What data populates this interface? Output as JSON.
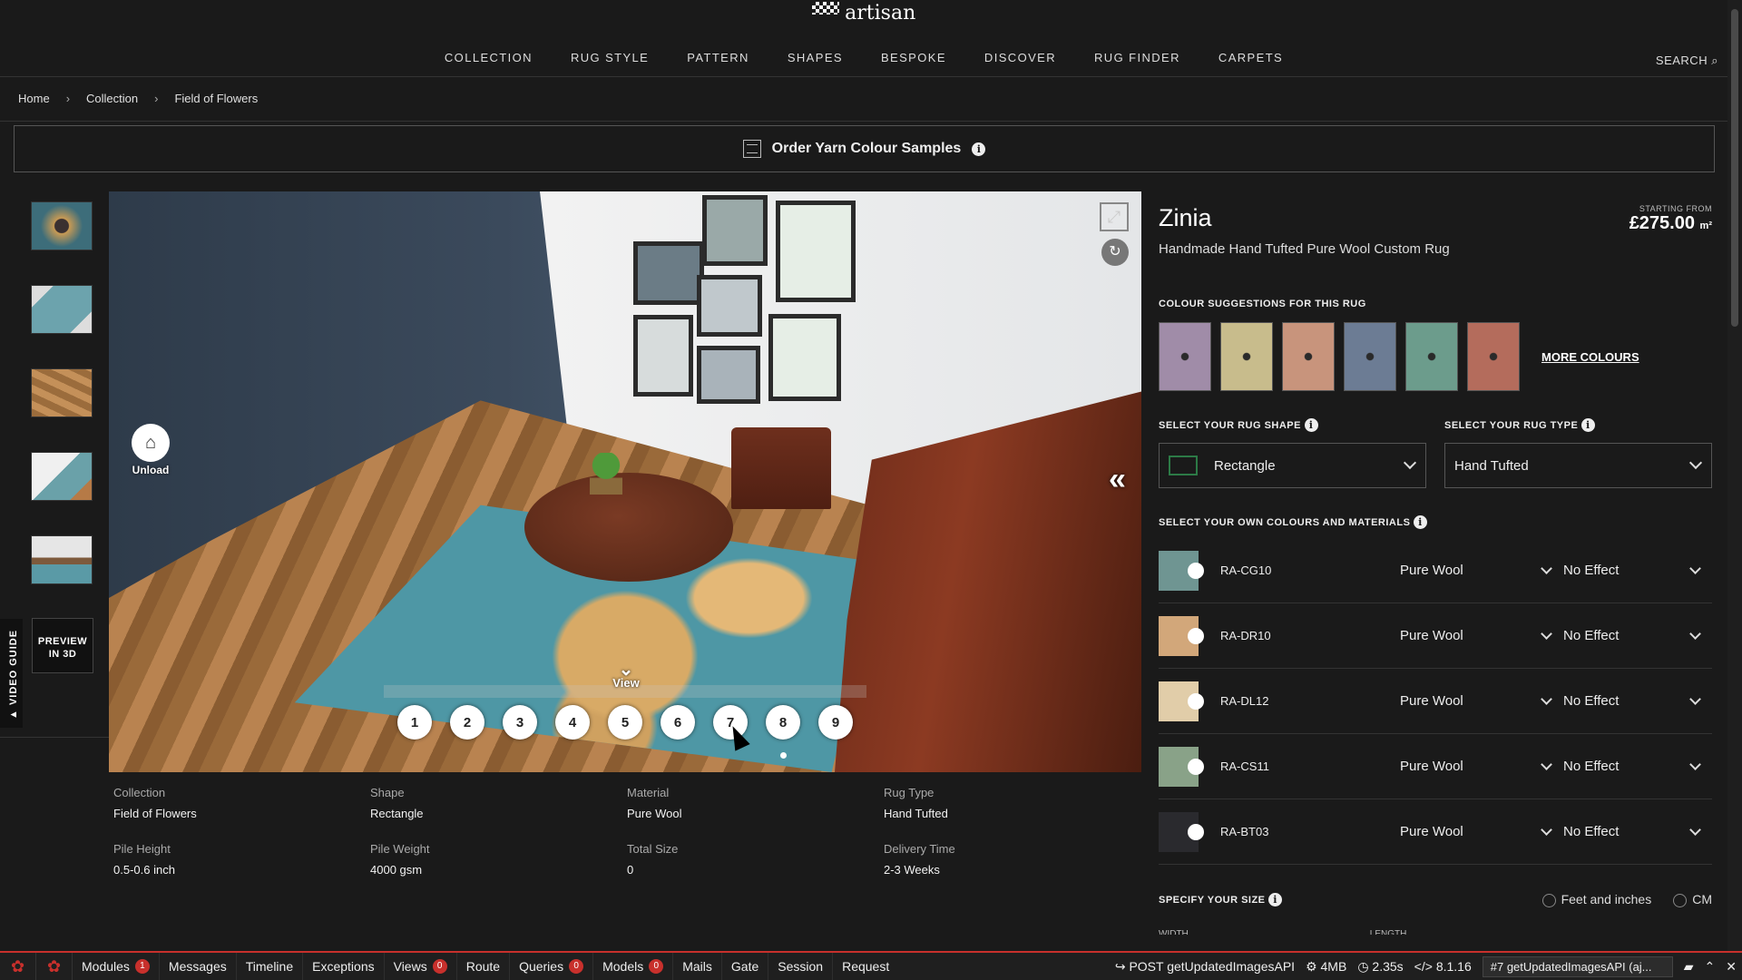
{
  "header": {
    "logo_main": "RUG",
    "logo_sub": "artisan",
    "nav": [
      "COLLECTION",
      "RUG STYLE",
      "PATTERN",
      "SHAPES",
      "BESPOKE",
      "DISCOVER",
      "RUG FINDER",
      "CARPETS"
    ],
    "search_label": "SEARCH"
  },
  "breadcrumb": [
    "Home",
    "Collection",
    "Field of Flowers"
  ],
  "banner": {
    "label": "Order Yarn Colour Samples"
  },
  "sidebar": {
    "thumbnails": [
      "thumb-1",
      "thumb-2",
      "thumb-3",
      "thumb-4",
      "thumb-5"
    ],
    "preview_3d": "PREVIEW IN 3D",
    "video_guide": "▲ VIDEO GUIDE"
  },
  "viewer": {
    "unload_label": "Unload",
    "view_label": "View",
    "views": [
      "1",
      "2",
      "3",
      "4",
      "5",
      "6",
      "7",
      "8",
      "9"
    ]
  },
  "specs": [
    {
      "key": "Collection",
      "value": "Field of Flowers"
    },
    {
      "key": "Shape",
      "value": "Rectangle"
    },
    {
      "key": "Material",
      "value": "Pure Wool"
    },
    {
      "key": "Rug Type",
      "value": "Hand Tufted"
    },
    {
      "key": "Pile Height",
      "value": "0.5-0.6 inch"
    },
    {
      "key": "Pile Weight",
      "value": "4000 gsm"
    },
    {
      "key": "Total Size",
      "value": "0"
    },
    {
      "key": "Delivery Time",
      "value": "2-3 Weeks"
    }
  ],
  "product": {
    "name": "Zinia",
    "subtitle": "Handmade Hand Tufted Pure Wool Custom Rug",
    "price_label": "STARTING FROM",
    "price": "£275.00",
    "price_unit": "m²"
  },
  "colour_suggestions": {
    "title": "COLOUR SUGGESTIONS FOR THIS RUG",
    "swatch_colors": [
      "#a08ca8",
      "#c8bc8c",
      "#c8947c",
      "#6c7c94",
      "#6c9c8c",
      "#b46c5c"
    ],
    "more": "MORE COLOURS"
  },
  "shape_select": {
    "title": "SELECT YOUR RUG SHAPE",
    "value": "Rectangle"
  },
  "type_select": {
    "title": "SELECT YOUR RUG TYPE",
    "value": "Hand Tufted"
  },
  "materials": {
    "title": "SELECT YOUR OWN COLOURS AND MATERIALS",
    "rows": [
      {
        "code": "RA-CG10",
        "color": "#6f9592",
        "material": "Pure Wool",
        "effect": "No Effect"
      },
      {
        "code": "RA-DR10",
        "color": "#d2a77a",
        "material": "Pure Wool",
        "effect": "No Effect"
      },
      {
        "code": "RA-DL12",
        "color": "#e1cda9",
        "material": "Pure Wool",
        "effect": "No Effect"
      },
      {
        "code": "RA-CS11",
        "color": "#89a288",
        "material": "Pure Wool",
        "effect": "No Effect"
      },
      {
        "code": "RA-BT03",
        "color": "#2a2a2e",
        "material": "Pure Wool",
        "effect": "No Effect"
      }
    ]
  },
  "size": {
    "title": "SPECIFY YOUR SIZE",
    "unit_feet": "Feet and inches",
    "unit_cm": "CM",
    "width_label": "WIDTH",
    "length_label": "LENGTH"
  },
  "debugbar": {
    "tabs": [
      {
        "label": "Modules",
        "badge": "1"
      },
      {
        "label": "Messages",
        "badge": ""
      },
      {
        "label": "Timeline",
        "badge": ""
      },
      {
        "label": "Exceptions",
        "badge": ""
      },
      {
        "label": "Views",
        "badge": "0"
      },
      {
        "label": "Route",
        "badge": ""
      },
      {
        "label": "Queries",
        "badge": "0"
      },
      {
        "label": "Models",
        "badge": "0"
      },
      {
        "label": "Mails",
        "badge": ""
      },
      {
        "label": "Gate",
        "badge": ""
      },
      {
        "label": "Session",
        "badge": ""
      },
      {
        "label": "Request",
        "badge": ""
      }
    ],
    "request": "POST getUpdatedImagesAPI",
    "memory": "4MB",
    "time": "2.35s",
    "php": "8.1.16",
    "request_select": "#7 getUpdatedImagesAPI (aj..."
  }
}
